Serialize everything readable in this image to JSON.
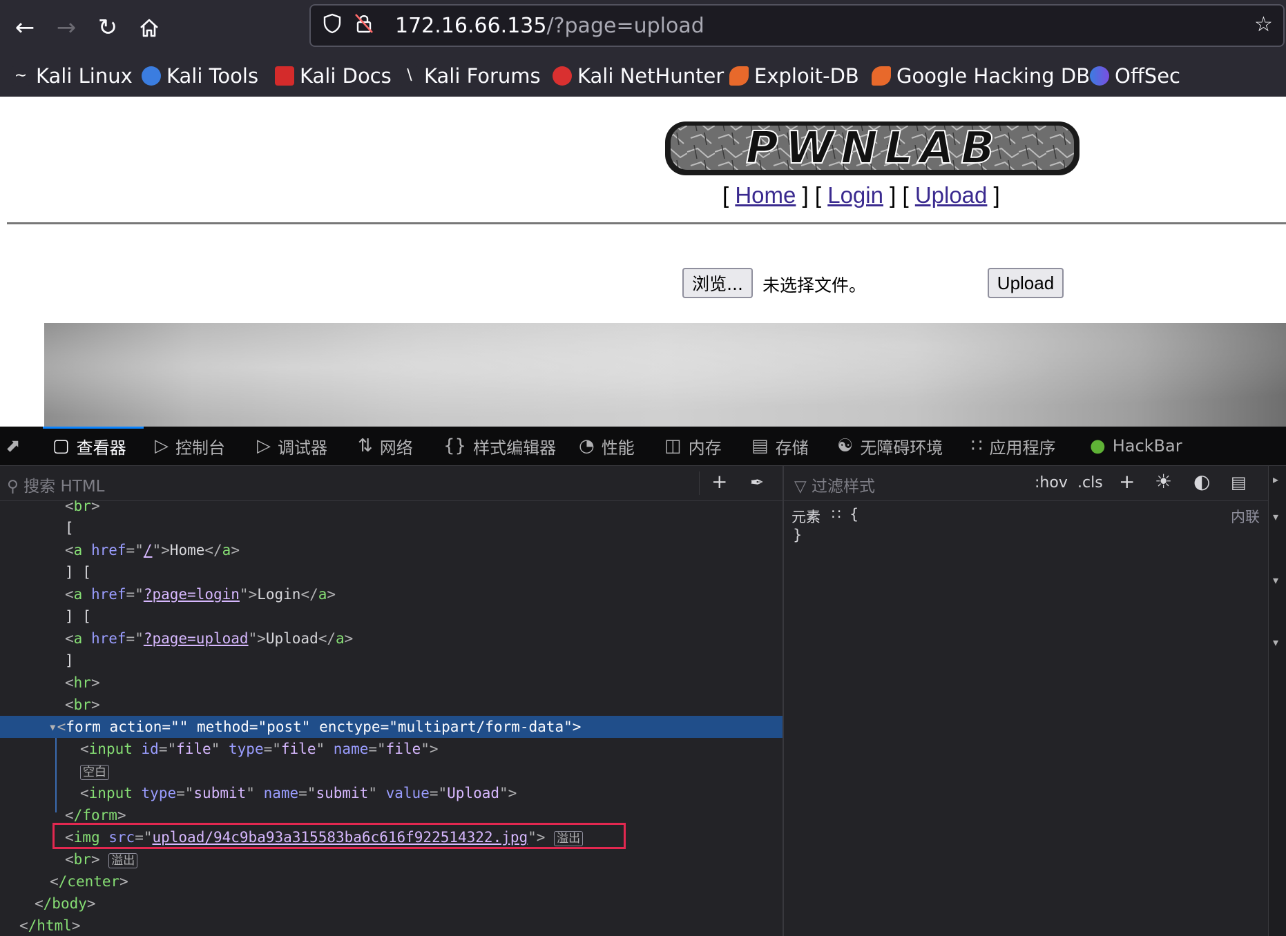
{
  "browser": {
    "url_host": "172.16.66.135",
    "url_path": "/?page=upload",
    "bookmarks": [
      "Kali Linux",
      "Kali Tools",
      "Kali Docs",
      "Kali Forums",
      "Kali NetHunter",
      "Exploit-DB",
      "Google Hacking DB",
      "OffSec"
    ],
    "nav_icons": [
      "back-icon",
      "forward-icon",
      "reload-icon",
      "home-icon"
    ],
    "url_icons": [
      "shield-icon",
      "insecure-lock-icon",
      "star-icon"
    ]
  },
  "page": {
    "logo_text": "PWNLAB",
    "nav": {
      "open1": "[ ",
      "home": "Home",
      "sep1": " ] [ ",
      "login": "Login",
      "sep2": " ] [ ",
      "upload": "Upload",
      "close": " ]"
    },
    "browse_label": "浏览...",
    "no_file_text": "未选择文件。",
    "upload_label": "Upload"
  },
  "devtools": {
    "tabs": [
      {
        "label": "查看器",
        "icon": "inspector-icon"
      },
      {
        "label": "控制台",
        "icon": "console-icon"
      },
      {
        "label": "调试器",
        "icon": "debugger-icon"
      },
      {
        "label": "网络",
        "icon": "network-icon"
      },
      {
        "label": "样式编辑器",
        "icon": "style-editor-icon"
      },
      {
        "label": "性能",
        "icon": "performance-icon"
      },
      {
        "label": "内存",
        "icon": "memory-icon"
      },
      {
        "label": "存储",
        "icon": "storage-icon"
      },
      {
        "label": "无障碍环境",
        "icon": "accessibility-icon"
      },
      {
        "label": "应用程序",
        "icon": "application-icon"
      },
      {
        "label": "HackBar",
        "icon": "hackbar-icon"
      }
    ],
    "search_placeholder": "搜索 HTML",
    "filter_placeholder": "过滤样式",
    "hov_label": ":hov",
    "cls_label": ".cls",
    "tree": {
      "br1": "br",
      "bracket_open": "[",
      "a_href_home": "/",
      "home_text": "Home",
      "sep1": "] [",
      "a_href_login": "?page=login",
      "login_text": "Login",
      "sep2": "] [",
      "a_href_upload": "?page=upload",
      "upload_text": "Upload",
      "bracket_close": "]",
      "hr": "hr",
      "br2": "br",
      "form_action": "",
      "form_method": "post",
      "form_enctype": "multipart/form-data",
      "input1_id": "file",
      "input1_type": "file",
      "input1_name": "file",
      "whitespace_badge": "空白",
      "input2_type": "submit",
      "input2_name": "submit",
      "input2_value": "Upload",
      "form_close": "/form",
      "img_src": "upload/94c9ba93a315583ba6c616f922514322.jpg",
      "overflow_badge": "溢出",
      "br3": "br",
      "center_close": "/center",
      "body_close": "/body",
      "html_close": "/html"
    },
    "rules": {
      "element_label": "元素",
      "open_brace": "{",
      "close_brace": "}",
      "inline_label": "内联"
    }
  },
  "colors": {
    "chrome_bg": "#2b2a33",
    "devtools_bg": "#232327",
    "selected_row": "#204e8a",
    "highlight_box": "#e22850",
    "link_color": "#3a2a8f"
  }
}
